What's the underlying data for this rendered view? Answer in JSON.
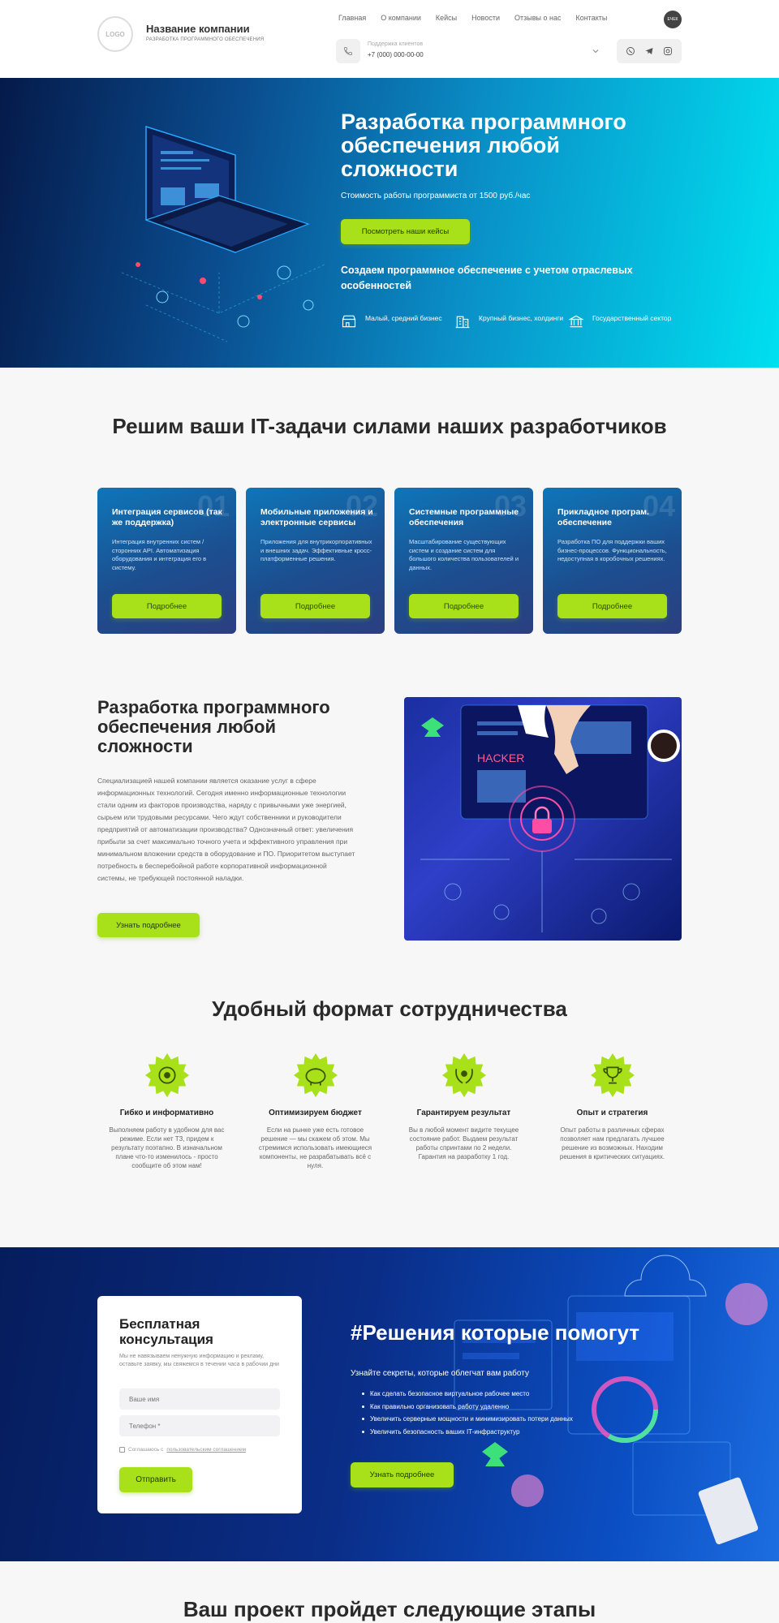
{
  "header": {
    "logo_text": "LOGO",
    "company_name": "Название компании",
    "company_sub": "РАЗРАБОТКА ПРОГРАММНОГО ОБЕСПЕЧЕНИЯ",
    "nav": [
      "Главная",
      "О компании",
      "Кейсы",
      "Новости",
      "Отзывы о нас",
      "Контакты"
    ],
    "avatar_text": "ЕЧЕК",
    "support_label": "Поддержка клиентов",
    "support_phone": "+7 (000) 000-00-00",
    "social_icons": [
      "whatsapp-icon",
      "telegram-icon",
      "instagram-icon"
    ]
  },
  "hero": {
    "title": "Разработка программного обеспечения любой сложности",
    "price": "Стоимость работы программиста от 1500 руб./час",
    "button": "Посмотреть наши кейсы",
    "subtitle": "Создаем программное обеспечение с учетом отраслевых особенностей",
    "segments": [
      {
        "icon": "shop-icon",
        "label": "Малый, средний бизнес"
      },
      {
        "icon": "office-building-icon",
        "label": "Крупный бизнес, холдинги"
      },
      {
        "icon": "government-building-icon",
        "label": "Государственный сектор"
      }
    ]
  },
  "services": {
    "title": "Решим ваши IT-задачи силами наших разработчиков",
    "cards": [
      {
        "num": "01",
        "title": "Интеграция сервисов (так же поддержка)",
        "text": "Интеграция внутренних систем / сторонних API. Автоматизация оборудования и интеграция его в систему.",
        "button": "Подробнее"
      },
      {
        "num": "02",
        "title": "Мобильные приложения и электронные сервисы",
        "text": "Приложения для внутрикорпоративных и внешних задач. Эффективные кросс-платформенные решения.",
        "button": "Подробнее"
      },
      {
        "num": "03",
        "title": "Системные программные обеспечения",
        "text": "Масштабирование существующих систем и создание систем для большого количества пользователей и данных.",
        "button": "Подробнее"
      },
      {
        "num": "04",
        "title": "Прикладное програм. обеспечение",
        "text": "Разработка ПО для поддержки ваших бизнес-процессов. Функциональность, недоступная в коробочных решениях.",
        "button": "Подробнее"
      }
    ]
  },
  "about": {
    "title": "Разработка программного обеспечения любой сложности",
    "text": "Специализацией нашей компании является оказание услуг в сфере информационных технологий. Сегодня именно информационные технологии стали одним из факторов производства, наряду с привычными уже энергией, сырьем или трудовыми ресурсами. Чего ждут собственники и руководители предприятий от автоматизации производства? Однозначный ответ: увеличения прибыли за счет максимально точного учета и эффективного управления при минимальном вложении средств в оборудование и ПО. Приоритетом выступает потребность в бесперебойной работе корпоративной информационной системы, не требующей постоянной наладки.",
    "button": "Узнать подробнее",
    "image_label": "HACKER"
  },
  "format": {
    "title": "Удобный формат сотрудничества",
    "items": [
      {
        "icon": "target-icon",
        "title": "Гибко и информативно",
        "text": "Выполняем работу в удобном для вас режиме. Если нет ТЗ, придем к результату поэтапно. В изначальном плане что-то изменилось - просто сообщите об этом нам!"
      },
      {
        "icon": "piggy-bank-icon",
        "title": "Оптимизируем бюджет",
        "text": "Если на рынке уже есть готовое решение — мы скажем об этом. Мы стремимся использовать имеющиеся компоненты, не разрабатывать всё с нуля."
      },
      {
        "icon": "laurel-award-icon",
        "title": "Гарантируем результат",
        "text": "Вы в любой момент видите текущее состояние работ. Выдаем результат работы спринтами по 2 недели. Гарантия на разработку 1 год."
      },
      {
        "icon": "trophy-icon",
        "title": "Опыт и стратегия",
        "text": "Опыт работы в различных сферах позволяет нам предлагать лучшее решение из возможных. Находим решения в критических ситуациях."
      }
    ]
  },
  "consult": {
    "form_title": "Бесплатная консультация",
    "form_desc": "Мы не навязываем ненужную информацию и рекламу, оставьте заявку, мы свяжемся в течении часа в рабочии дни",
    "name_placeholder": "Ваше имя",
    "phone_placeholder": "Телефон *",
    "agree_text": "Соглашаюсь с",
    "agree_link": "пользовательским соглашением",
    "submit": "Отправить",
    "title": "#Решения которые помогут",
    "lead": "Узнайте секреты, которые облегчат вам работу",
    "list": [
      "Как сделать безопасное виртуальное рабочее место",
      "Как правильно организовать работу удаленно",
      "Увеличить серверные мощности и минимизировать потери данных",
      "Увеличить безопасность ваших IT-инфраструктур"
    ],
    "button": "Узнать подробнее"
  },
  "stages": {
    "title": "Ваш проект пройдет следующие этапы"
  }
}
